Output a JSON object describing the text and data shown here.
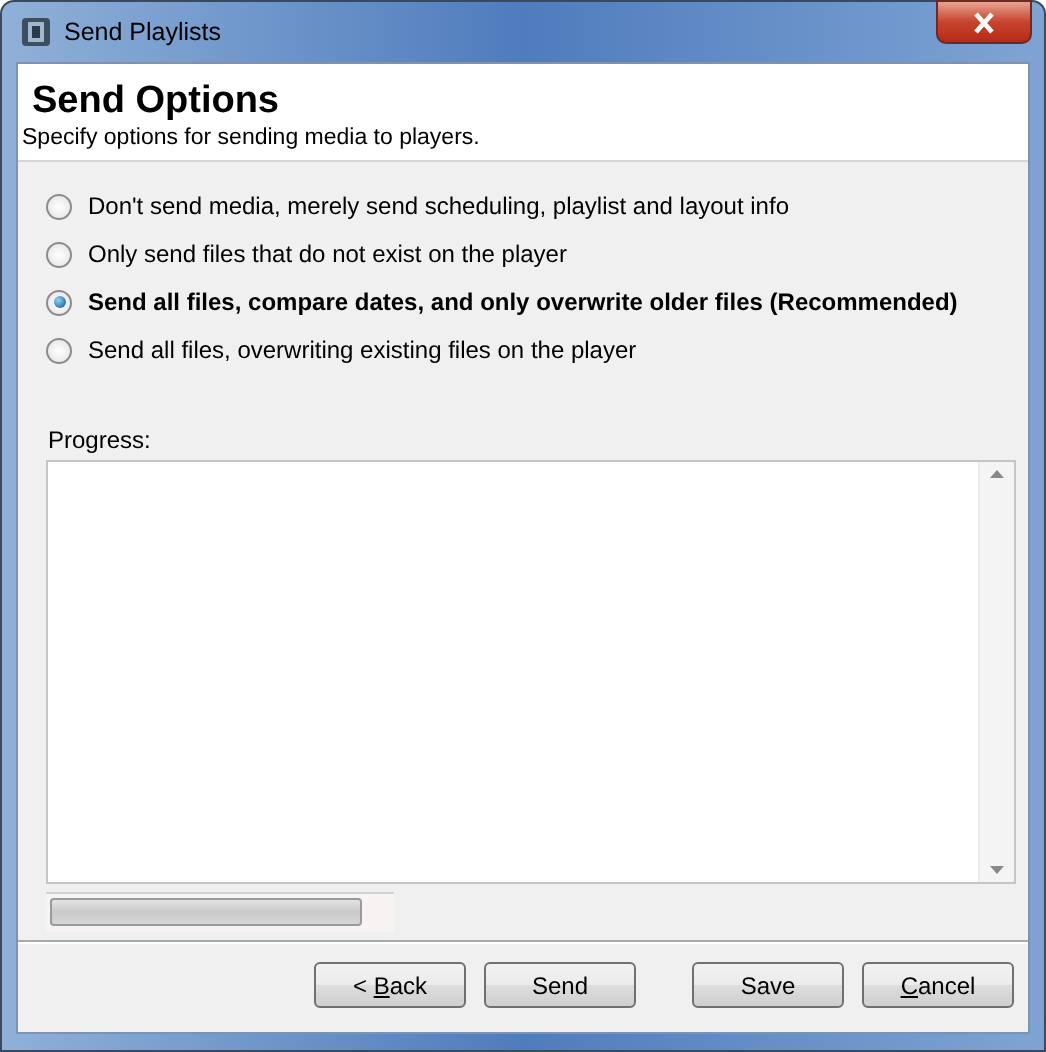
{
  "window": {
    "title": "Send Playlists"
  },
  "header": {
    "title": "Send Options",
    "subtitle": "Specify options for sending media to players."
  },
  "options": [
    {
      "label": "Don't send media, merely send scheduling, playlist and layout info",
      "selected": false
    },
    {
      "label": "Only send files that do not exist on the player",
      "selected": false
    },
    {
      "label": "Send all files, compare dates, and only overwrite older files (Recommended)",
      "selected": true
    },
    {
      "label": "Send all files, overwriting existing files on the player",
      "selected": false
    }
  ],
  "progress": {
    "label": "Progress:"
  },
  "buttons": [
    {
      "before": "< ",
      "key": "B",
      "after": "ack"
    },
    {
      "before": "Send"
    },
    {
      "before": "Save"
    },
    {
      "key": "C",
      "after": "ancel"
    }
  ]
}
